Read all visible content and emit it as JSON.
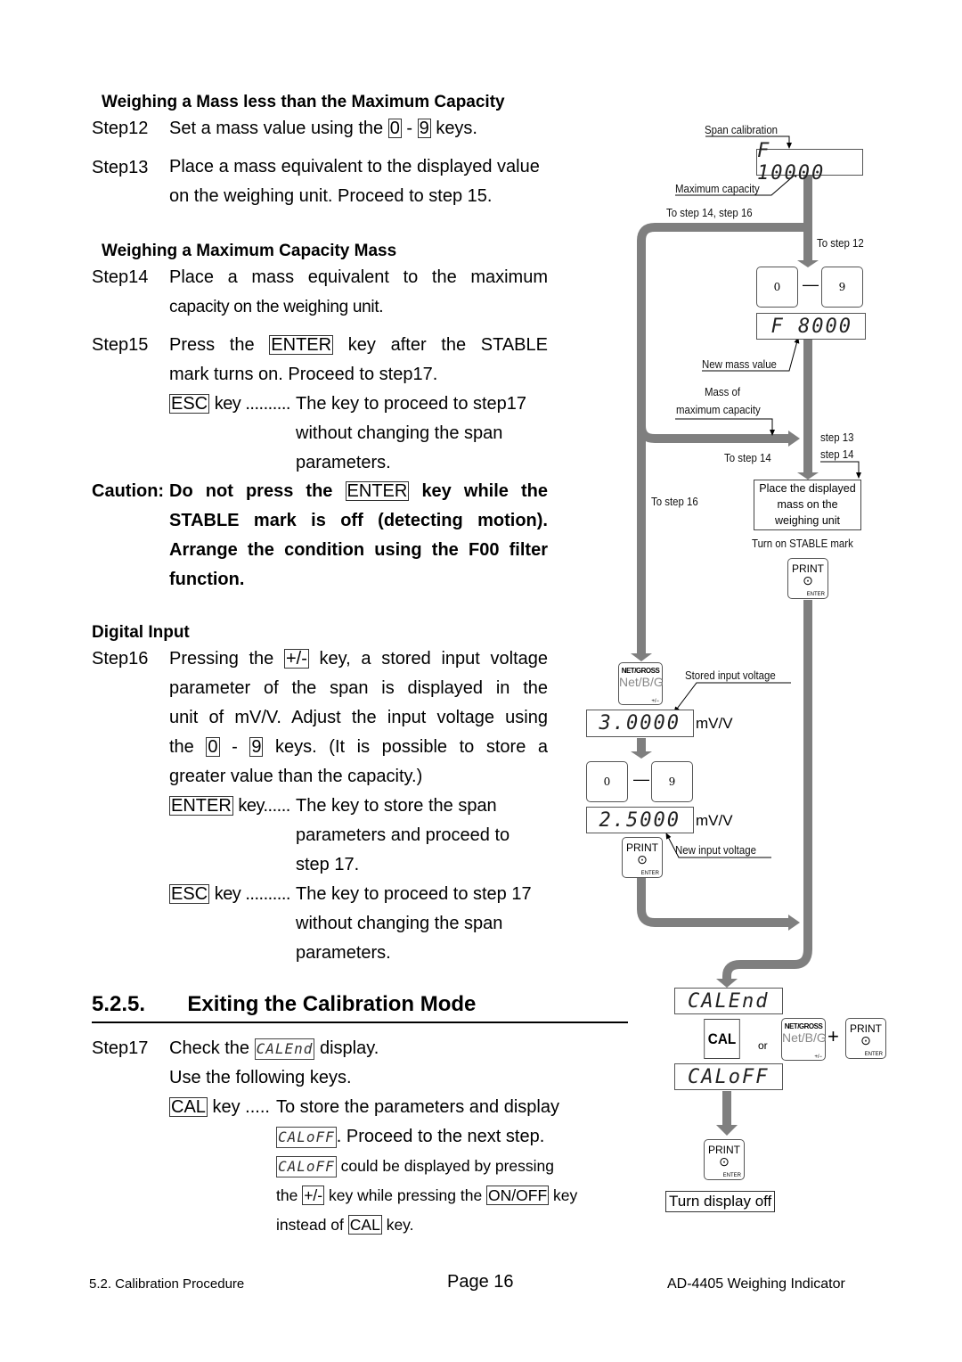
{
  "sections": {
    "less_than_max": {
      "heading": "Weighing a Mass less than the Maximum Capacity",
      "step12": {
        "label": "Step12",
        "pre": "Set a mass value using the",
        "key_a": "0",
        "dash": "-",
        "key_b": "9",
        "post": "keys."
      },
      "step13": {
        "label": "Step13",
        "line1": "Place a mass equivalent to the displayed value",
        "line2": "on the weighing unit. Proceed to step 15."
      }
    },
    "max_capacity": {
      "heading": "Weighing a Maximum Capacity Mass",
      "step14": {
        "label": "Step14",
        "line1": "Place a mass equivalent to the maximum",
        "line2": "capacity on the weighing unit."
      },
      "step15": {
        "label": "Step15",
        "line1_pre": "Press the",
        "line1_key": "ENTER",
        "line1_post": "key after the STABLE",
        "line2": "mark turns on. Proceed to step17.",
        "esc_key": "ESC",
        "esc_dots": "key ..........",
        "esc_desc": [
          "The key to proceed to step17",
          "without changing the span",
          "parameters."
        ]
      },
      "caution": {
        "label": "Caution:",
        "line1_pre": "Do not press the",
        "line1_key": "ENTER",
        "line1_post": "key while the",
        "line2": "STABLE mark is off (detecting motion).",
        "line3": "Arrange the condition using the F00 filter",
        "line4": "function."
      }
    },
    "digital_input": {
      "heading": "Digital Input",
      "step16": {
        "label": "Step16",
        "line1_pre": "Pressing the",
        "line1_key": "+/-",
        "line1_post": "key, a stored input voltage",
        "line2": "parameter of the span is displayed in the",
        "line3": "unit of mV/V. Adjust the input voltage using",
        "line4_pre": "the",
        "line4_key_a": "0",
        "line4_dash": "-",
        "line4_key_b": "9",
        "line4_post": "keys. (It is possible to store a",
        "line5": "greater value than the capacity.)",
        "enter_key": "ENTER",
        "enter_dots": "key......",
        "enter_desc": [
          "The key to store the span",
          "parameters and proceed to",
          "step 17."
        ],
        "esc_key": "ESC",
        "esc_dots": "key ..........",
        "esc_desc": [
          "The key to proceed to step 17",
          "without changing the span",
          "parameters."
        ]
      }
    },
    "exit": {
      "number": "5.2.5.",
      "title": "Exiting the Calibration Mode",
      "step17": {
        "label": "Step17",
        "line1_pre": "Check the",
        "line1_lcd": "CALEnd",
        "line1_post": "display.",
        "line2": "Use the following keys.",
        "cal_key": "CAL",
        "cal_dots": "key .....",
        "cal_desc1": "To store the parameters and display",
        "cal_desc2_lcd": "CALoFF",
        "cal_desc2_post": ". Proceed to the next step.",
        "cal_desc3_lcd": "CALoFF",
        "cal_desc3_post": "could be displayed by pressing",
        "cal_desc4_pre": "the",
        "cal_desc4_key": "+/-",
        "cal_desc4_mid": "key while pressing the",
        "cal_desc4_key2": "ON/OFF",
        "cal_desc4_post": "key",
        "cal_desc5_pre": "instead of",
        "cal_desc5_key": "CAL",
        "cal_desc5_post": "key."
      }
    }
  },
  "diagram": {
    "span_calibration": "Span calibration",
    "lcd_span": "F 10000",
    "maximum_capacity": "Maximum capacity",
    "to_step_14_16": "To step 14, step 16",
    "to_step_12": "To step 12",
    "key_0": "0",
    "key_9": "9",
    "range_dash": "—",
    "lcd_new": "F  8000",
    "new_mass_value": "New mass value",
    "mass_of_max_1": "Mass of",
    "mass_of_max_2": "maximum capacity",
    "to_step_14": "To step 14",
    "step13": "step 13",
    "step14": "step 14",
    "to_step_16": "To step 16",
    "place_box": [
      "Place the displayed",
      "mass on the",
      "weighing unit"
    ],
    "turn_on_stable": "Turn on STABLE mark",
    "print_key": {
      "top": "PRINT",
      "symbol": "⊙",
      "bottom": "ENTER"
    },
    "net_key": {
      "top": "NET/GROSS",
      "middle": "Net/B/G",
      "bottom": "+/−"
    },
    "stored_input_voltage": "Stored input voltage",
    "lcd_stored": "3.0000",
    "unit": "mV/V",
    "lcd_input": "2.5000",
    "new_input_voltage": "New input voltage",
    "lcd_calend": "CALEnd",
    "cal_key": "CAL",
    "or": "or",
    "plus": "+",
    "lcd_caloff": "CALoFF",
    "turn_display_off": "Turn display off"
  },
  "footer": {
    "left": "5.2. Calibration Procedure",
    "center": "Page 16",
    "right": "AD-4405 Weighing Indicator"
  },
  "colors": {
    "flow_arrow": "#7f7f7f"
  }
}
